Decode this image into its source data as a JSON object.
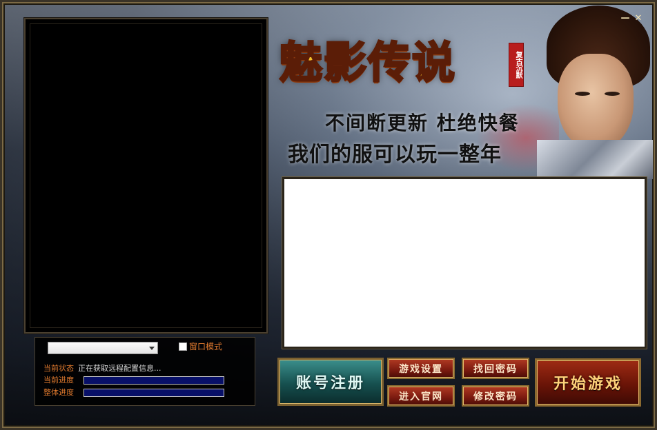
{
  "window": {
    "minimize_icon": "minimize-icon",
    "close_icon": "close-icon",
    "minimize_glyph": "—",
    "close_glyph": "✕"
  },
  "banner": {
    "logo_text": "魅影传说",
    "seal_text": "复古沉默",
    "slogan_line1": "不间断更新 杜绝快餐",
    "slogan_line2": "我们的服可以玩一整年"
  },
  "controls": {
    "server_select_value": "",
    "window_mode_label": "窗口模式",
    "window_mode_checked": false,
    "status_label": "当前状态",
    "status_value": "正在获取远程配置信息...",
    "current_progress_label": "当前进度",
    "overall_progress_label": "整体进度",
    "current_progress_pct": 0,
    "overall_progress_pct": 0
  },
  "buttons": {
    "register": "账号注册",
    "game_settings": "游戏设置",
    "recover_password": "找回密码",
    "official_site": "进入官网",
    "change_password": "修改密码",
    "start_game": "开始游戏"
  },
  "colors": {
    "accent_orange": "#e07a2e",
    "progress_bg": "#081068",
    "start_gold": "#ffd27a"
  }
}
